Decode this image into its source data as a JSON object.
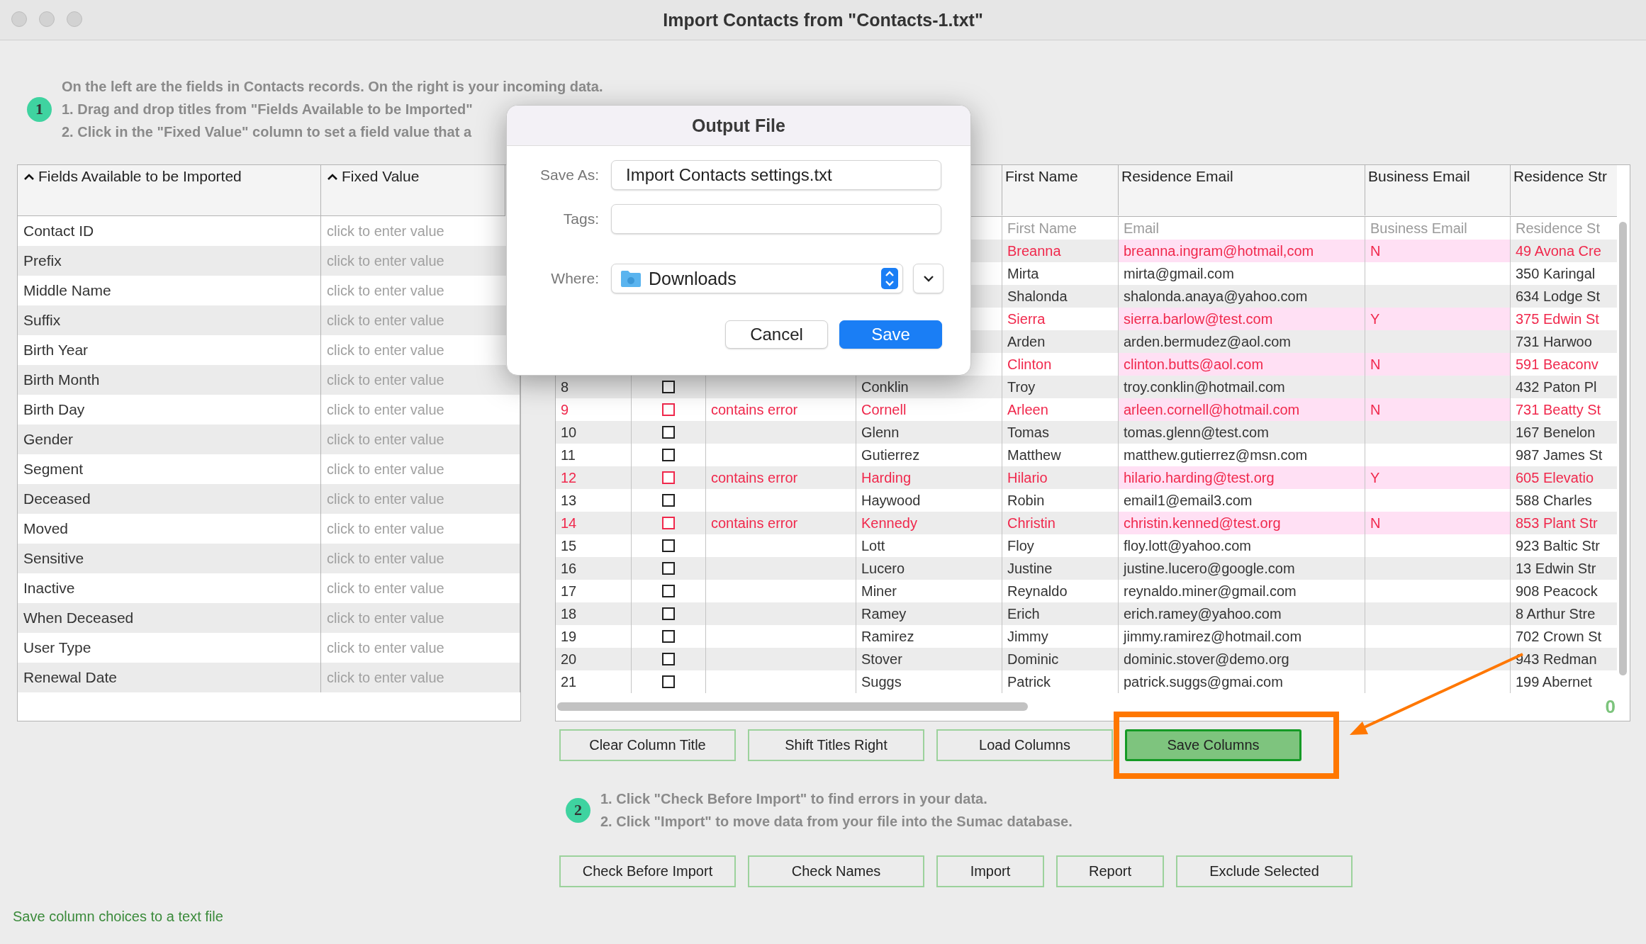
{
  "window": {
    "title": "Import Contacts from \"Contacts-1.txt\""
  },
  "step1": {
    "badge": "1",
    "lines": [
      "On the left are the fields in Contacts records. On the right is your incoming data.",
      "1. Drag and drop titles from \"Fields Available to be Imported\"",
      "2. Click in the \"Fixed Value\" column to set a field value that a"
    ]
  },
  "fields_table": {
    "columns": [
      {
        "label": "Fields Available to be Imported",
        "sorted": true
      },
      {
        "label": "Fixed Value",
        "sorted": true
      }
    ],
    "rows": [
      {
        "field": "Contact ID",
        "placeholder": "click to enter value"
      },
      {
        "field": "Prefix",
        "placeholder": "click to enter value"
      },
      {
        "field": "Middle Name",
        "placeholder": "click to enter value"
      },
      {
        "field": "Suffix",
        "placeholder": "click to enter value"
      },
      {
        "field": "Birth Year",
        "placeholder": "click to enter value"
      },
      {
        "field": "Birth Month",
        "placeholder": "click to enter value"
      },
      {
        "field": "Birth Day",
        "placeholder": "click to enter value"
      },
      {
        "field": "Gender",
        "placeholder": "click to enter value"
      },
      {
        "field": "Segment",
        "placeholder": "click to enter value"
      },
      {
        "field": "Deceased",
        "placeholder": "click to enter value"
      },
      {
        "field": "Moved",
        "placeholder": "click to enter value"
      },
      {
        "field": "Sensitive",
        "placeholder": "click to enter value"
      },
      {
        "field": "Inactive",
        "placeholder": "click to enter value"
      },
      {
        "field": "When Deceased",
        "placeholder": "click to enter value"
      },
      {
        "field": "User Type",
        "placeholder": "click to enter value"
      },
      {
        "field": "Renewal Date",
        "placeholder": "click to enter value"
      }
    ]
  },
  "import_table": {
    "columns": [
      "First Name",
      "Residence Email",
      "Business Email",
      "Residence Str"
    ],
    "rows": [
      {
        "kind": "file-header",
        "error": false,
        "first_name": "First Name",
        "email": "Email",
        "business_email": "Business Email",
        "street": "Residence St"
      },
      {
        "kind": "record",
        "error": true,
        "first_name": "Breanna",
        "email": "breanna.ingram@hotmail,com",
        "business_email": "N",
        "street": "49 Avona Cre"
      },
      {
        "kind": "record",
        "error": false,
        "first_name": "Mirta",
        "email": "mirta@gmail.com",
        "street": "350 Karingal"
      },
      {
        "kind": "record",
        "error": false,
        "first_name": "Shalonda",
        "email": "shalonda.anaya@yahoo.com",
        "street": "634 Lodge St"
      },
      {
        "kind": "record",
        "error": true,
        "first_name": "Sierra",
        "email": "sierra.barlow@test.com",
        "business_email": "Y",
        "street": "375 Edwin St"
      },
      {
        "kind": "record",
        "error": false,
        "first_name": "Arden",
        "email": "arden.bermudez@aol.com",
        "street": "731 Harwoo"
      },
      {
        "kind": "record",
        "error": true,
        "first_name": "Clinton",
        "email": "clinton.butts@aol.com",
        "business_email": "N",
        "street": "591 Beaconv"
      },
      {
        "kind": "record",
        "error": false,
        "number": "8",
        "checked": false,
        "last_name": "Conklin",
        "first_name": "Troy",
        "email": "troy.conklin@hotmail.com",
        "street": "432 Paton Pl"
      },
      {
        "kind": "record",
        "error": true,
        "number": "9",
        "checked": false,
        "status": "contains error",
        "last_name": "Cornell",
        "first_name": "Arleen",
        "email": "arleen.cornell@hotmail.com",
        "business_email": "N",
        "street": "731 Beatty St"
      },
      {
        "kind": "record",
        "error": false,
        "number": "10",
        "checked": false,
        "last_name": "Glenn",
        "first_name": "Tomas",
        "email": "tomas.glenn@test.com",
        "street": "167 Benelon"
      },
      {
        "kind": "record",
        "error": false,
        "number": "11",
        "checked": false,
        "last_name": "Gutierrez",
        "first_name": "Matthew",
        "email": "matthew.gutierrez@msn.com",
        "street": "987 James St"
      },
      {
        "kind": "record",
        "error": true,
        "number": "12",
        "checked": false,
        "status": "contains error",
        "last_name": "Harding",
        "first_name": "Hilario",
        "email": "hilario.harding@test.org",
        "business_email": "Y",
        "street": "605 Elevatio"
      },
      {
        "kind": "record",
        "error": false,
        "number": "13",
        "checked": false,
        "last_name": "Haywood",
        "first_name": "Robin",
        "email": "email1@email3.com",
        "street": "588 Charles"
      },
      {
        "kind": "record",
        "error": true,
        "number": "14",
        "checked": false,
        "status": "contains error",
        "last_name": "Kennedy",
        "first_name": "Christin",
        "email": "christin.kenned@test.org",
        "business_email": "N",
        "street": "853 Plant Str"
      },
      {
        "kind": "record",
        "error": false,
        "number": "15",
        "checked": false,
        "last_name": "Lott",
        "first_name": "Floy",
        "email": "floy.lott@yahoo.com",
        "street": "923 Baltic Str"
      },
      {
        "kind": "record",
        "error": false,
        "number": "16",
        "checked": false,
        "last_name": "Lucero",
        "first_name": "Justine",
        "email": "justine.lucero@google.com",
        "street": "13 Edwin Str"
      },
      {
        "kind": "record",
        "error": false,
        "number": "17",
        "checked": false,
        "last_name": "Miner",
        "first_name": "Reynaldo",
        "email": "reynaldo.miner@gmail.com",
        "street": "908 Peacock"
      },
      {
        "kind": "record",
        "error": false,
        "number": "18",
        "checked": false,
        "last_name": "Ramey",
        "first_name": "Erich",
        "email": "erich.ramey@yahoo.com",
        "street": "8 Arthur Stre"
      },
      {
        "kind": "record",
        "error": false,
        "number": "19",
        "checked": false,
        "last_name": "Ramirez",
        "first_name": "Jimmy",
        "email": "jimmy.ramirez@hotmail.com",
        "street": "702 Crown St"
      },
      {
        "kind": "record",
        "error": false,
        "number": "20",
        "checked": false,
        "last_name": "Stover",
        "first_name": "Dominic",
        "email": "dominic.stover@demo.org",
        "street": "943 Redman"
      },
      {
        "kind": "record",
        "error": false,
        "number": "21",
        "checked": false,
        "last_name": "Suggs",
        "first_name": "Patrick",
        "email": "patrick.suggs@gmai.com",
        "street": "199 Abernet"
      }
    ],
    "counter": "0"
  },
  "column_buttons": [
    {
      "label": "Clear Column Title",
      "active": false,
      "highlighted": false
    },
    {
      "label": "Shift Titles Right",
      "active": false,
      "highlighted": false
    },
    {
      "label": "Load Columns",
      "active": false,
      "highlighted": false
    },
    {
      "label": "Save Columns",
      "active": true,
      "highlighted": true
    }
  ],
  "step2": {
    "badge": "2",
    "lines": [
      "1. Click \"Check Before Import\" to find errors in your data.",
      "2. Click \"Import\" to move data from your file into the Sumac database."
    ]
  },
  "import_buttons": [
    {
      "label": "Check Before Import"
    },
    {
      "label": "Check Names"
    },
    {
      "label": "Import"
    },
    {
      "label": "Report"
    },
    {
      "label": "Exclude Selected"
    }
  ],
  "dialog": {
    "title": "Output File",
    "fields": [
      {
        "label": "Save As:",
        "value": "Import Contacts settings.txt"
      },
      {
        "label": "Tags:"
      }
    ],
    "where": {
      "label": "Where:",
      "value": "Downloads"
    },
    "buttons": [
      {
        "label": "Cancel",
        "default": false
      },
      {
        "label": "Save",
        "default": true
      }
    ]
  },
  "status_bar": "Save column choices to a text file"
}
